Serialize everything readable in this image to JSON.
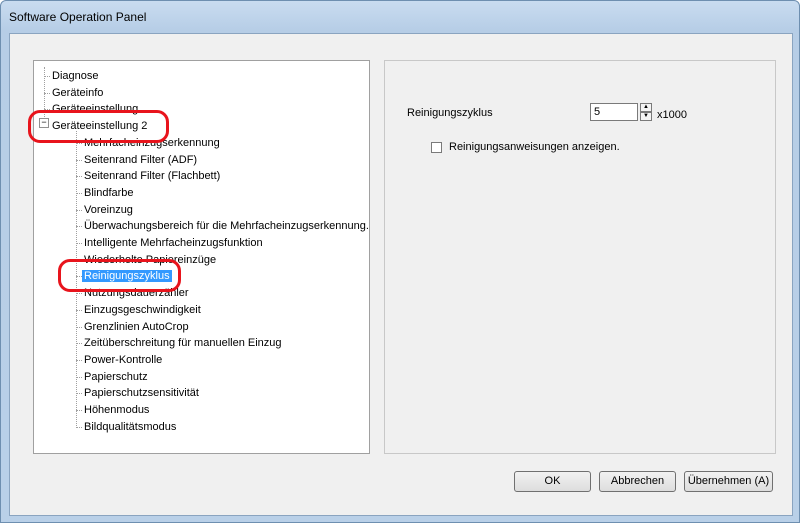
{
  "window": {
    "title": "Software Operation Panel"
  },
  "tree": {
    "items": [
      {
        "label": "Diagnose"
      },
      {
        "label": "Geräteinfo"
      },
      {
        "label": "Geräteeinstellung"
      },
      {
        "label": "Geräteeinstellung 2",
        "expanded": true
      },
      {
        "label": "Mehrfacheinzugserkennung"
      },
      {
        "label": "Seitenrand Filter (ADF)"
      },
      {
        "label": "Seitenrand Filter (Flachbett)"
      },
      {
        "label": "Blindfarbe"
      },
      {
        "label": "Voreinzug"
      },
      {
        "label": "Überwachungsbereich für die Mehrfacheinzugserkennung."
      },
      {
        "label": "Intelligente Mehrfacheinzugsfunktion"
      },
      {
        "label": "Wiederholte Papiereinzüge"
      },
      {
        "label": "Reinigungszyklus",
        "selected": true
      },
      {
        "label": "Nutzungsdauerzähler"
      },
      {
        "label": "Einzugsgeschwindigkeit"
      },
      {
        "label": "Grenzlinien AutoCrop"
      },
      {
        "label": "Zeitüberschreitung für manuellen Einzug"
      },
      {
        "label": "Power-Kontrolle"
      },
      {
        "label": "Papierschutz"
      },
      {
        "label": "Papierschutzsensitivität"
      },
      {
        "label": "Höhenmodus"
      },
      {
        "label": "Bildqualitätsmodus"
      }
    ],
    "expander_symbol": "−"
  },
  "settings": {
    "cycle_label": "Reinigungszyklus",
    "cycle_value": "5",
    "cycle_unit": "x1000",
    "spin_up": "▲",
    "spin_down": "▼",
    "show_instructions_label": "Reinigungsanweisungen anzeigen.",
    "show_instructions_checked": false
  },
  "buttons": {
    "ok": "OK",
    "cancel": "Abbrechen",
    "apply": "Übernehmen (A)"
  },
  "colors": {
    "highlight_ring": "#e8141c",
    "selection": "#3399ff"
  }
}
